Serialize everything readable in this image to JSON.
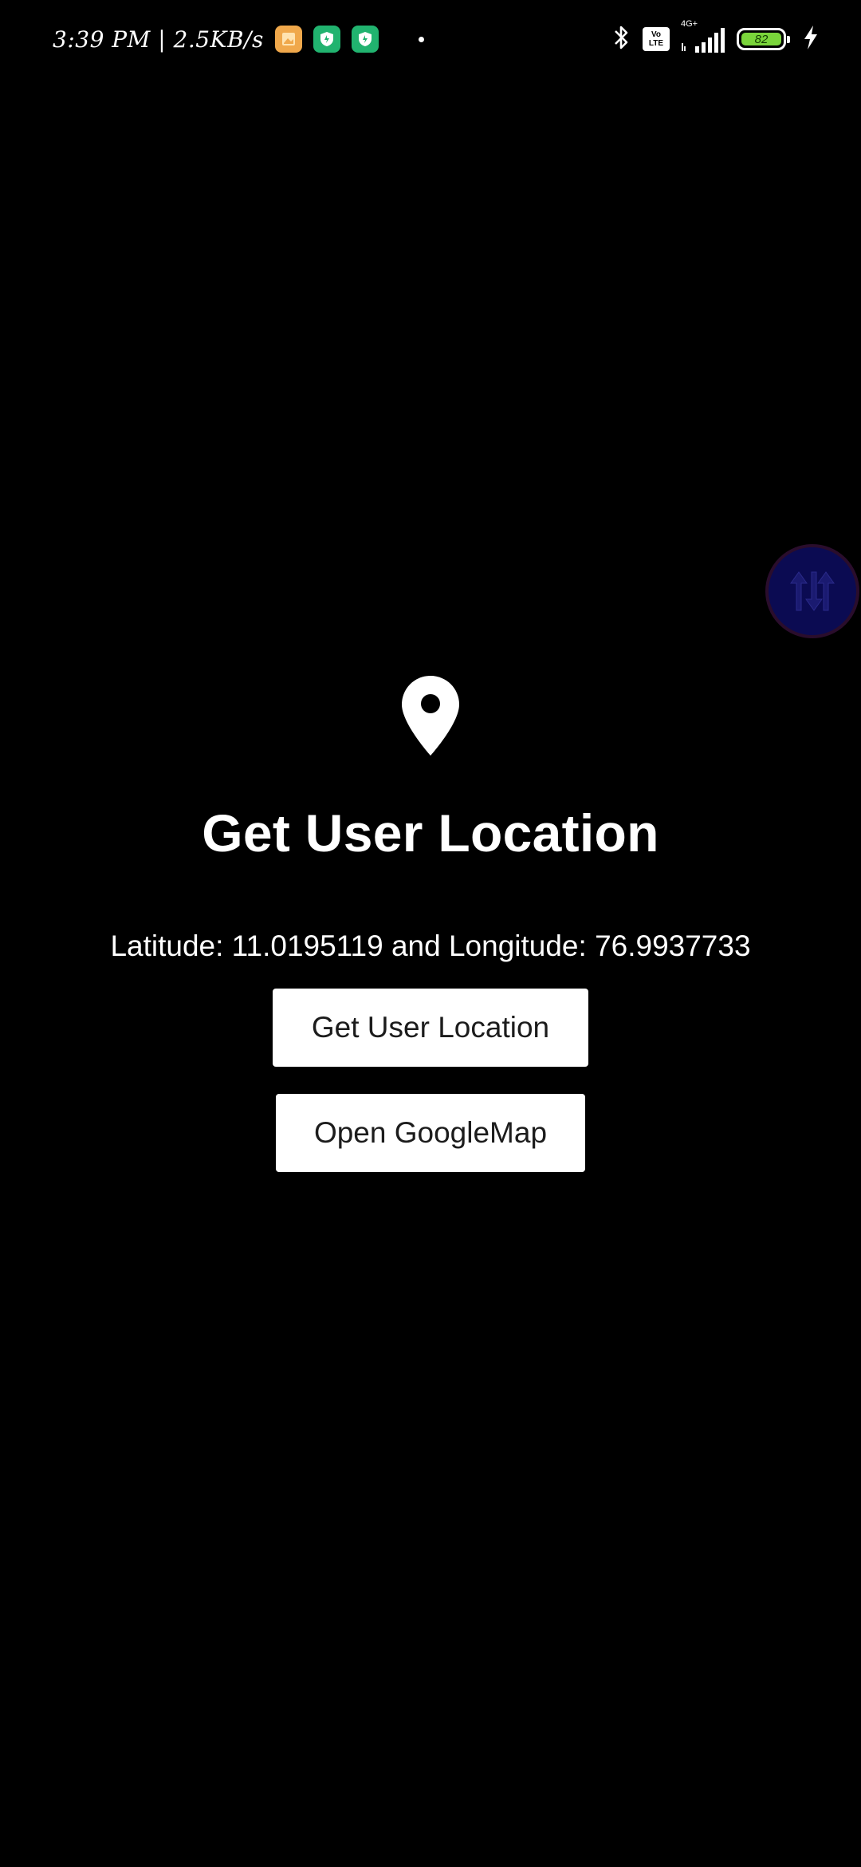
{
  "status_bar": {
    "time_speed": "3:39 PM | 2.5KB/s",
    "network_type": "4G+",
    "volte_top": "Vo",
    "volte_bottom": "LTE",
    "battery_level": "82",
    "battery_color": "#7ad43b"
  },
  "main": {
    "icon": "location-pin-icon",
    "title": "Get User Location",
    "coordinates_text": "Latitude: 11.0195119 and Longitude: 76.9937733",
    "get_location_button": "Get User Location",
    "open_map_button": "Open GoogleMap"
  },
  "colors": {
    "background": "#000000",
    "text": "#ffffff",
    "button_bg": "#ffffff",
    "button_text": "#1c1c1c",
    "floating_button": "#0b0b52"
  }
}
